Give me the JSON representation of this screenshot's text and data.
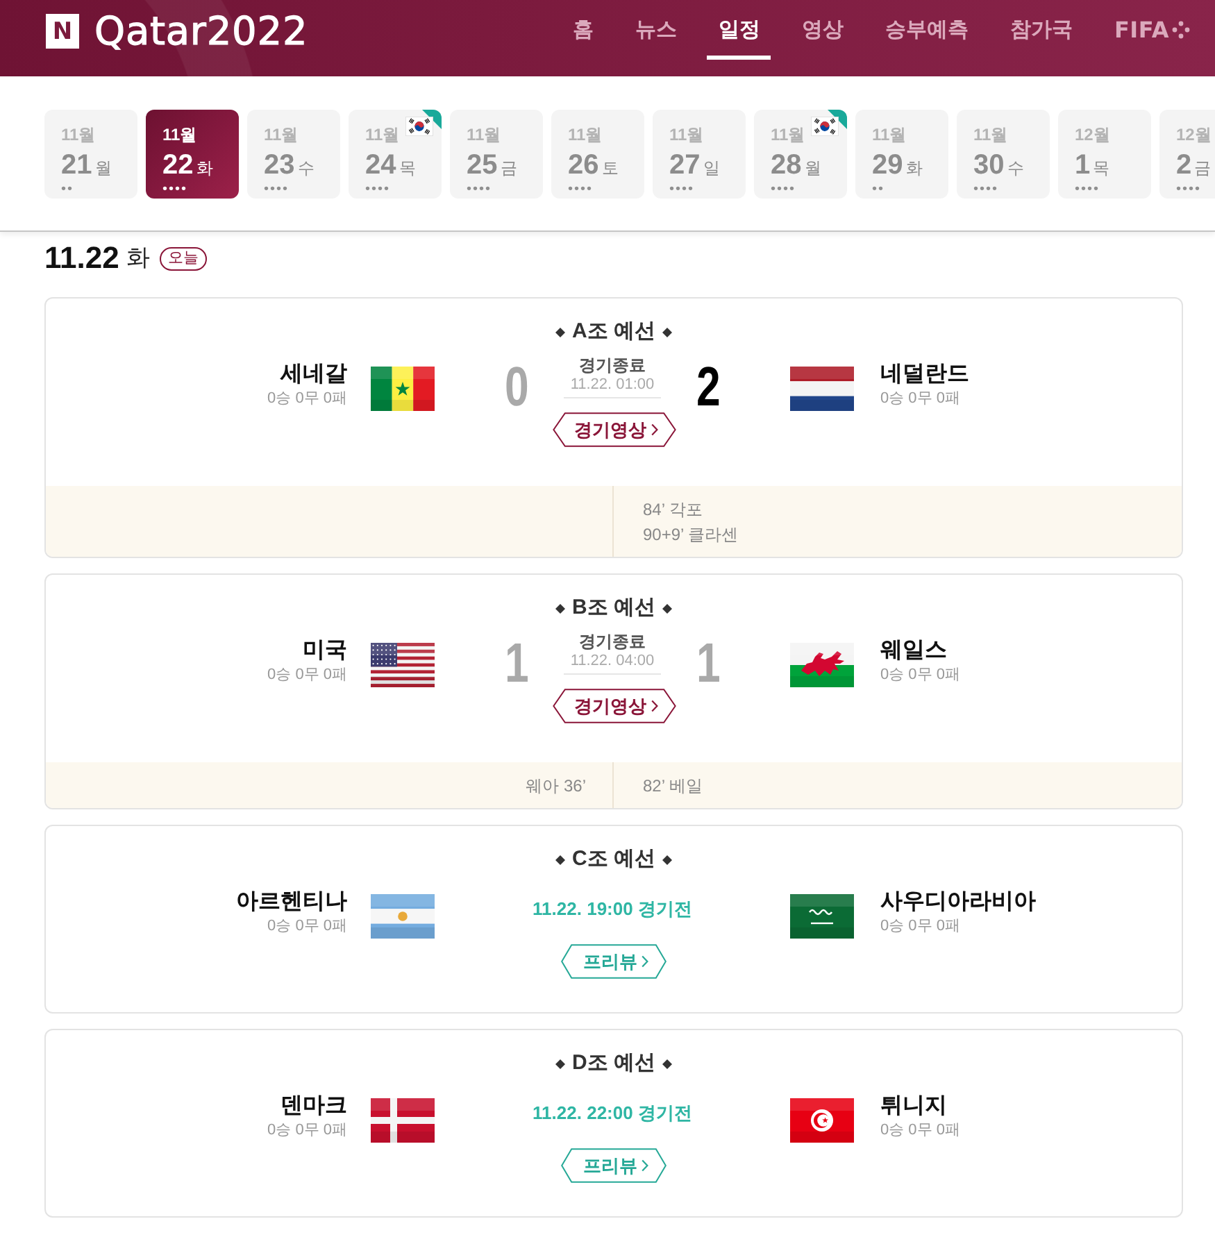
{
  "header": {
    "logo_badge": "N",
    "logo_text": "Qatar2022",
    "nav": [
      {
        "label": "홈",
        "selected": false,
        "kind": "text"
      },
      {
        "label": "뉴스",
        "selected": false,
        "kind": "text"
      },
      {
        "label": "일정",
        "selected": true,
        "kind": "text"
      },
      {
        "label": "영상",
        "selected": false,
        "kind": "text"
      },
      {
        "label": "승부예측",
        "selected": false,
        "kind": "text"
      },
      {
        "label": "참가국",
        "selected": false,
        "kind": "text"
      },
      {
        "label": "FIFA",
        "selected": false,
        "kind": "brand"
      }
    ]
  },
  "dates": [
    {
      "month": "11월",
      "day": "21",
      "weekday": "월",
      "marks": "••",
      "selected": false,
      "korea_match": false
    },
    {
      "month": "11월",
      "day": "22",
      "weekday": "화",
      "marks": "••••",
      "selected": true,
      "korea_match": false
    },
    {
      "month": "11월",
      "day": "23",
      "weekday": "수",
      "marks": "••••",
      "selected": false,
      "korea_match": false
    },
    {
      "month": "11월",
      "day": "24",
      "weekday": "목",
      "marks": "••••",
      "selected": false,
      "korea_match": true
    },
    {
      "month": "11월",
      "day": "25",
      "weekday": "금",
      "marks": "••••",
      "selected": false,
      "korea_match": false
    },
    {
      "month": "11월",
      "day": "26",
      "weekday": "토",
      "marks": "••••",
      "selected": false,
      "korea_match": false
    },
    {
      "month": "11월",
      "day": "27",
      "weekday": "일",
      "marks": "••••",
      "selected": false,
      "korea_match": false
    },
    {
      "month": "11월",
      "day": "28",
      "weekday": "월",
      "marks": "••••",
      "selected": false,
      "korea_match": true
    },
    {
      "month": "11월",
      "day": "29",
      "weekday": "화",
      "marks": "••",
      "selected": false,
      "korea_match": false
    },
    {
      "month": "11월",
      "day": "30",
      "weekday": "수",
      "marks": "••••",
      "selected": false,
      "korea_match": false
    },
    {
      "month": "12월",
      "day": "1",
      "weekday": "목",
      "marks": "••••",
      "selected": false,
      "korea_match": false
    },
    {
      "month": "12월",
      "day": "2",
      "weekday": "금",
      "marks": "••••",
      "selected": false,
      "korea_match": false
    }
  ],
  "day_heading": {
    "date": "11.22",
    "weekday": "화",
    "badge": "오늘"
  },
  "matches": [
    {
      "group": "A조 예선",
      "kind": "finished",
      "status": "경기종료",
      "time": "11.22. 01:00",
      "home": {
        "name": "세네갈",
        "record": "0승 0무 0패",
        "kind": "senegal",
        "score": "0",
        "winner": false
      },
      "away": {
        "name": "네덜란드",
        "record": "0승 0무 0패",
        "kind": "netherlands",
        "score": "2",
        "winner": true
      },
      "button": "경기영상",
      "events": {
        "away": [
          "84’ 각포",
          "90+9’ 클라센"
        ]
      }
    },
    {
      "group": "B조 예선",
      "kind": "finished",
      "status": "경기종료",
      "time": "11.22. 04:00",
      "home": {
        "name": "미국",
        "record": "0승 0무 0패",
        "kind": "usa",
        "score": "1",
        "winner": false
      },
      "away": {
        "name": "웨일스",
        "record": "0승 0무 0패",
        "kind": "wales",
        "score": "1",
        "winner": false
      },
      "button": "경기영상",
      "events": {
        "home": [
          "웨아 36’"
        ],
        "away": [
          "82’ 베일"
        ]
      }
    },
    {
      "group": "C조 예선",
      "kind": "upcoming",
      "status": "11.22. 19:00 경기전",
      "home": {
        "name": "아르헨티나",
        "record": "0승 0무 0패",
        "kind": "argentina"
      },
      "away": {
        "name": "사우디아라비아",
        "record": "0승 0무 0패",
        "kind": "saudi"
      },
      "button": "프리뷰"
    },
    {
      "group": "D조 예선",
      "kind": "upcoming",
      "status": "11.22. 22:00 경기전",
      "home": {
        "name": "덴마크",
        "record": "0승 0무 0패",
        "kind": "denmark"
      },
      "away": {
        "name": "튀니지",
        "record": "0승 0무 0패",
        "kind": "tunisia"
      },
      "button": "프리뷰"
    }
  ]
}
